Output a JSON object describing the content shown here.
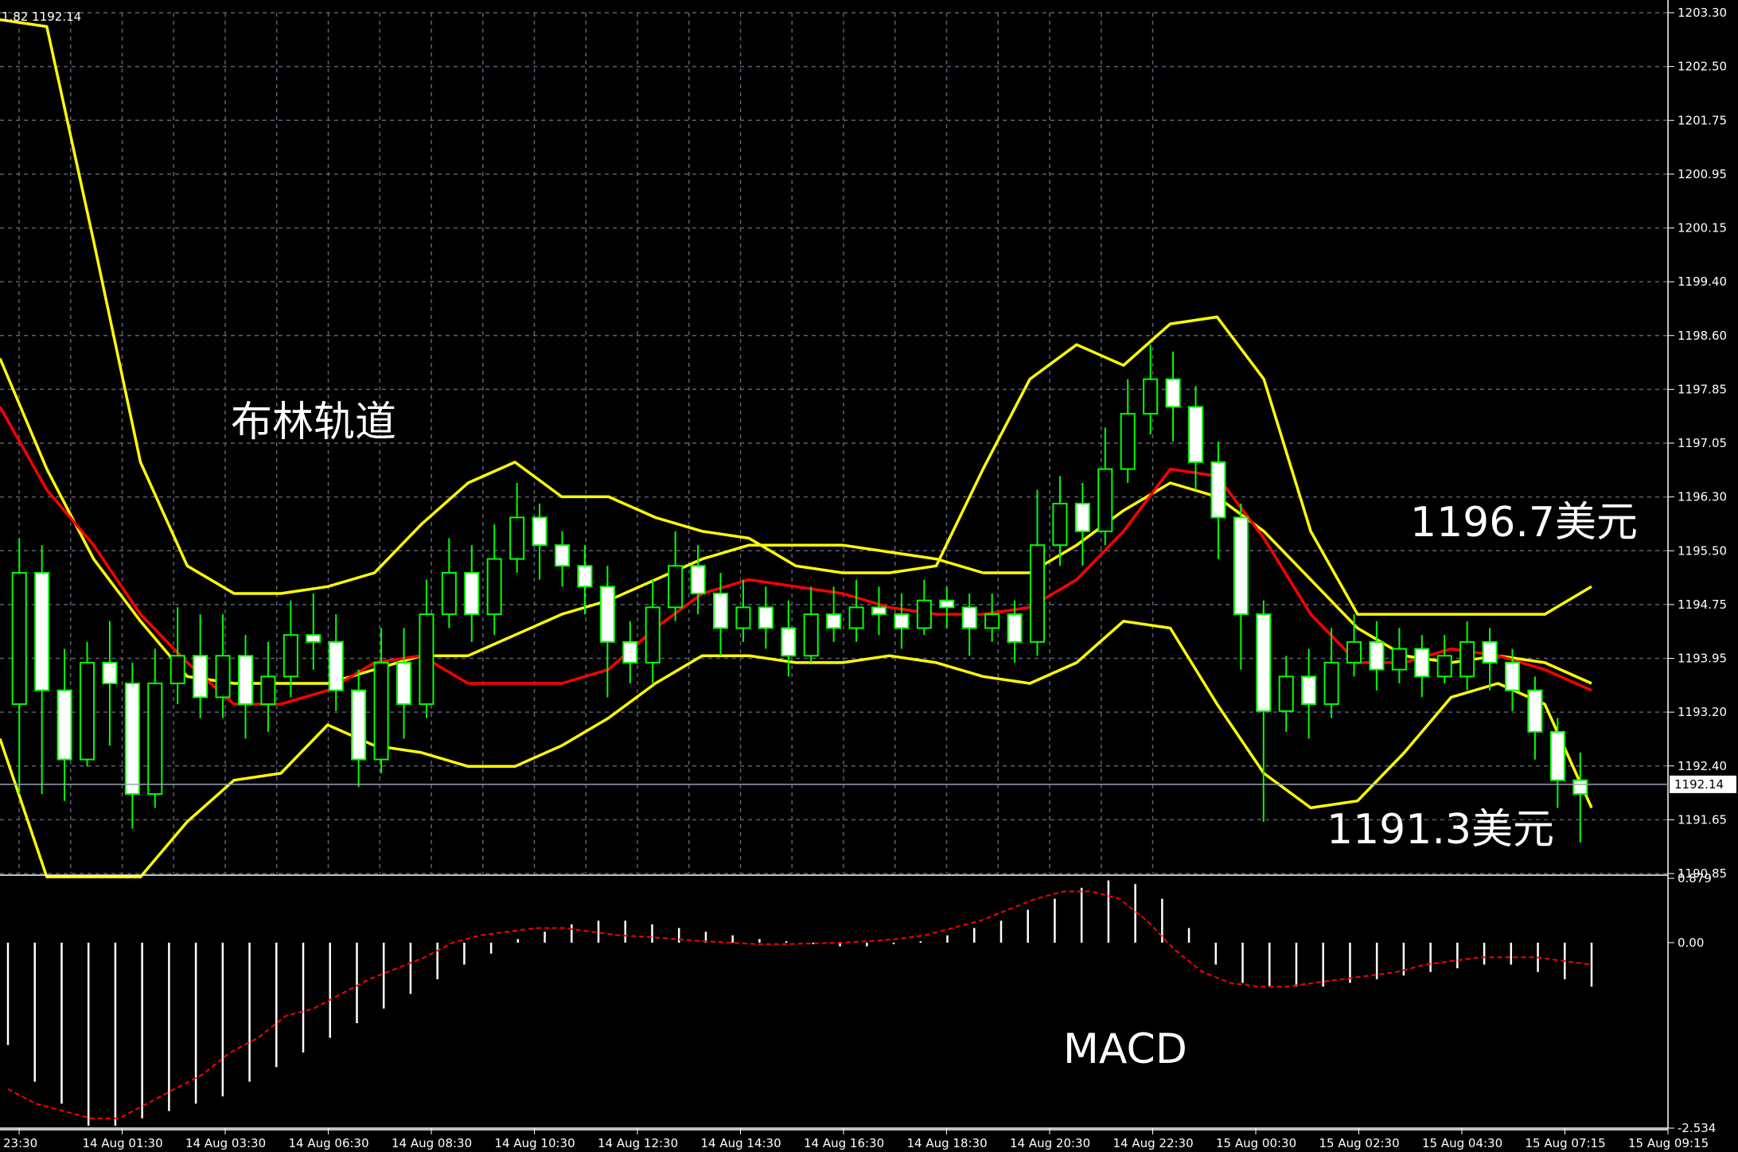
{
  "chart_data": {
    "type": "line",
    "ohlc_readout": "1.82 1192.14",
    "current_price": "1192.14",
    "y_ticks": [
      "1203.30",
      "1202.50",
      "1201.75",
      "1200.95",
      "1200.15",
      "1199.40",
      "1198.60",
      "1197.85",
      "1197.05",
      "1196.30",
      "1195.50",
      "1194.75",
      "1193.95",
      "1193.20",
      "1192.40",
      "1191.65",
      "1190.85"
    ],
    "ylim": [
      1190.85,
      1203.3
    ],
    "x_ticks": [
      "23:30",
      "14 Aug 01:30",
      "14 Aug 03:30",
      "14 Aug 06:30",
      "14 Aug 08:30",
      "14 Aug 10:30",
      "14 Aug 12:30",
      "14 Aug 14:30",
      "14 Aug 16:30",
      "14 Aug 18:30",
      "14 Aug 20:30",
      "14 Aug 22:30",
      "15 Aug 00:30",
      "15 Aug 02:30",
      "15 Aug 04:30",
      "15 Aug 07:15",
      "15 Aug 09:15"
    ],
    "annotations": {
      "bollinger": "布林轨道",
      "upper_value": "1196.7美元",
      "lower_value": "1191.3美元",
      "macd": "MACD"
    },
    "macd_ticks": [
      "0.879",
      "0.00",
      "-2.534"
    ],
    "macd_ylim": [
      -2.534,
      0.879
    ],
    "bands": {
      "middle": [
        1197.6,
        1196.4,
        1195.6,
        1194.6,
        1193.9,
        1193.3,
        1193.3,
        1193.5,
        1193.9,
        1194.0,
        1193.6,
        1193.6,
        1193.6,
        1193.8,
        1194.4,
        1194.9,
        1195.1,
        1195.0,
        1194.9,
        1194.7,
        1194.6,
        1194.6,
        1194.7,
        1195.1,
        1195.8,
        1196.7,
        1196.6,
        1195.7,
        1194.6,
        1193.9,
        1193.9,
        1194.1,
        1194.0,
        1193.8,
        1193.5
      ],
      "upper": [
        1198.3,
        1196.7,
        1195.4,
        1194.5,
        1193.7,
        1193.6,
        1193.6,
        1193.6,
        1193.8,
        1194.0,
        1194.0,
        1194.3,
        1194.6,
        1194.8,
        1195.1,
        1195.4,
        1195.6,
        1195.6,
        1195.6,
        1195.5,
        1195.4,
        1195.2,
        1195.2,
        1195.6,
        1196.1,
        1196.5,
        1196.3,
        1195.8,
        1195.1,
        1194.4,
        1194.0,
        1193.9,
        1194.0,
        1193.9,
        1193.6
      ],
      "outer_upper": [
        1203.2,
        1203.1,
        1200.0,
        1196.8,
        1195.3,
        1194.9,
        1194.9,
        1195.0,
        1195.2,
        1195.9,
        1196.5,
        1196.8,
        1196.3,
        1196.3,
        1196.0,
        1195.8,
        1195.7,
        1195.3,
        1195.2,
        1195.2,
        1195.3,
        1196.7,
        1198.0,
        1198.5,
        1198.2,
        1198.8,
        1198.9,
        1198.0,
        1195.8,
        1194.6,
        1194.6,
        1194.6,
        1194.6,
        1194.6,
        1195.0
      ],
      "outer_lower": [
        1192.8,
        1190.8,
        1190.8,
        1190.8,
        1191.6,
        1192.2,
        1192.3,
        1193.0,
        1192.7,
        1192.6,
        1192.4,
        1192.4,
        1192.7,
        1193.1,
        1193.6,
        1194.0,
        1194.0,
        1193.9,
        1193.9,
        1194.0,
        1193.9,
        1193.7,
        1193.6,
        1193.9,
        1194.5,
        1194.4,
        1193.3,
        1192.3,
        1191.8,
        1191.9,
        1192.6,
        1193.4,
        1193.6,
        1193.3,
        1191.8
      ]
    },
    "candles": [
      [
        1193.3,
        1195.2,
        1195.7,
        1192.0
      ],
      [
        1195.2,
        1193.5,
        1195.6,
        1192.0
      ],
      [
        1193.5,
        1192.5,
        1194.1,
        1191.9
      ],
      [
        1192.5,
        1193.9,
        1194.2,
        1192.4
      ],
      [
        1193.9,
        1193.6,
        1194.5,
        1192.7
      ],
      [
        1193.6,
        1192.0,
        1193.9,
        1191.5
      ],
      [
        1192.0,
        1193.6,
        1194.1,
        1191.8
      ],
      [
        1193.6,
        1194.0,
        1194.7,
        1193.3
      ],
      [
        1194.0,
        1193.4,
        1194.6,
        1193.1
      ],
      [
        1193.4,
        1194.0,
        1194.6,
        1193.1
      ],
      [
        1194.0,
        1193.3,
        1194.3,
        1192.8
      ],
      [
        1193.3,
        1193.7,
        1194.2,
        1192.9
      ],
      [
        1193.7,
        1194.3,
        1194.8,
        1193.4
      ],
      [
        1194.3,
        1194.2,
        1194.9,
        1193.8
      ],
      [
        1194.2,
        1193.5,
        1194.6,
        1193.2
      ],
      [
        1193.5,
        1192.5,
        1193.8,
        1192.1
      ],
      [
        1192.5,
        1193.9,
        1194.4,
        1192.3
      ],
      [
        1193.9,
        1193.3,
        1194.4,
        1192.8
      ],
      [
        1193.3,
        1194.6,
        1195.1,
        1193.1
      ],
      [
        1194.6,
        1195.2,
        1195.7,
        1194.4
      ],
      [
        1195.2,
        1194.6,
        1195.6,
        1194.2
      ],
      [
        1194.6,
        1195.4,
        1195.9,
        1194.3
      ],
      [
        1195.4,
        1196.0,
        1196.5,
        1195.2
      ],
      [
        1196.0,
        1195.6,
        1196.2,
        1195.1
      ],
      [
        1195.6,
        1195.3,
        1195.8,
        1195.0
      ],
      [
        1195.3,
        1195.0,
        1195.6,
        1194.6
      ],
      [
        1195.0,
        1194.2,
        1195.3,
        1193.4
      ],
      [
        1194.2,
        1193.9,
        1194.5,
        1193.6
      ],
      [
        1193.9,
        1194.7,
        1195.1,
        1193.6
      ],
      [
        1194.7,
        1195.3,
        1195.8,
        1194.5
      ],
      [
        1195.3,
        1194.9,
        1195.6,
        1194.6
      ],
      [
        1194.9,
        1194.4,
        1195.2,
        1194.0
      ],
      [
        1194.4,
        1194.7,
        1195.1,
        1194.2
      ],
      [
        1194.7,
        1194.4,
        1195.0,
        1194.1
      ],
      [
        1194.4,
        1194.0,
        1194.8,
        1193.7
      ],
      [
        1194.0,
        1194.6,
        1195.0,
        1193.9
      ],
      [
        1194.6,
        1194.4,
        1195.0,
        1194.2
      ],
      [
        1194.4,
        1194.7,
        1195.1,
        1194.2
      ],
      [
        1194.7,
        1194.6,
        1195.0,
        1194.3
      ],
      [
        1194.6,
        1194.4,
        1194.9,
        1194.1
      ],
      [
        1194.4,
        1194.8,
        1195.1,
        1194.3
      ],
      [
        1194.8,
        1194.7,
        1195.0,
        1194.4
      ],
      [
        1194.7,
        1194.4,
        1194.9,
        1194.0
      ],
      [
        1194.4,
        1194.6,
        1194.9,
        1194.2
      ],
      [
        1194.6,
        1194.2,
        1194.8,
        1193.9
      ],
      [
        1194.2,
        1195.6,
        1196.4,
        1194.0
      ],
      [
        1195.6,
        1196.2,
        1196.6,
        1195.3
      ],
      [
        1196.2,
        1195.8,
        1196.5,
        1195.3
      ],
      [
        1195.8,
        1196.7,
        1197.3,
        1195.6
      ],
      [
        1196.7,
        1197.5,
        1198.0,
        1196.5
      ],
      [
        1197.5,
        1198.0,
        1198.5,
        1197.2
      ],
      [
        1198.0,
        1197.6,
        1198.4,
        1197.1
      ],
      [
        1197.6,
        1196.8,
        1197.9,
        1196.4
      ],
      [
        1196.8,
        1196.0,
        1197.1,
        1195.4
      ],
      [
        1196.0,
        1194.6,
        1196.2,
        1193.8
      ],
      [
        1194.6,
        1193.2,
        1194.8,
        1191.6
      ],
      [
        1193.2,
        1193.7,
        1194.0,
        1192.9
      ],
      [
        1193.7,
        1193.3,
        1194.1,
        1192.8
      ],
      [
        1193.3,
        1193.9,
        1194.4,
        1193.1
      ],
      [
        1193.9,
        1194.2,
        1194.6,
        1193.7
      ],
      [
        1194.2,
        1193.8,
        1194.5,
        1193.5
      ],
      [
        1193.8,
        1194.1,
        1194.4,
        1193.6
      ],
      [
        1194.1,
        1193.7,
        1194.3,
        1193.4
      ],
      [
        1193.7,
        1194.0,
        1194.3,
        1193.6
      ],
      [
        1193.7,
        1194.2,
        1194.5,
        1193.5
      ],
      [
        1194.2,
        1193.9,
        1194.4,
        1193.5
      ],
      [
        1193.9,
        1193.5,
        1194.1,
        1193.2
      ],
      [
        1193.5,
        1192.9,
        1193.7,
        1192.5
      ],
      [
        1192.9,
        1192.2,
        1193.1,
        1191.8
      ],
      [
        1192.2,
        1192.0,
        1192.6,
        1191.3
      ]
    ],
    "macd": {
      "hist": [
        -1.4,
        -1.9,
        -2.2,
        -2.5,
        -2.5,
        -2.4,
        -2.3,
        -2.2,
        -2.1,
        -1.9,
        -1.7,
        -1.5,
        -1.3,
        -1.1,
        -0.9,
        -0.7,
        -0.5,
        -0.3,
        -0.15,
        0.05,
        0.15,
        0.25,
        0.3,
        0.3,
        0.25,
        0.2,
        0.15,
        0.1,
        0.05,
        0.02,
        -0.02,
        -0.05,
        -0.05,
        -0.02,
        0.02,
        0.1,
        0.2,
        0.3,
        0.45,
        0.6,
        0.75,
        0.85,
        0.8,
        0.6,
        0.2,
        -0.3,
        -0.55,
        -0.6,
        -0.6,
        -0.6,
        -0.55,
        -0.5,
        -0.45,
        -0.4,
        -0.35,
        -0.3,
        -0.3,
        -0.4,
        -0.5,
        -0.6
      ],
      "signal": [
        -2.0,
        -2.2,
        -2.3,
        -2.4,
        -2.4,
        -2.2,
        -2.0,
        -1.8,
        -1.5,
        -1.3,
        -1.0,
        -0.9,
        -0.7,
        -0.5,
        -0.35,
        -0.2,
        0.0,
        0.1,
        0.15,
        0.2,
        0.2,
        0.15,
        0.1,
        0.08,
        0.05,
        0.02,
        0.0,
        -0.02,
        -0.02,
        -0.01,
        0.0,
        0.02,
        0.05,
        0.1,
        0.2,
        0.3,
        0.45,
        0.6,
        0.7,
        0.7,
        0.6,
        0.3,
        -0.1,
        -0.4,
        -0.55,
        -0.6,
        -0.6,
        -0.55,
        -0.5,
        -0.45,
        -0.4,
        -0.3,
        -0.25,
        -0.2,
        -0.2,
        -0.2,
        -0.25,
        -0.3
      ]
    }
  }
}
